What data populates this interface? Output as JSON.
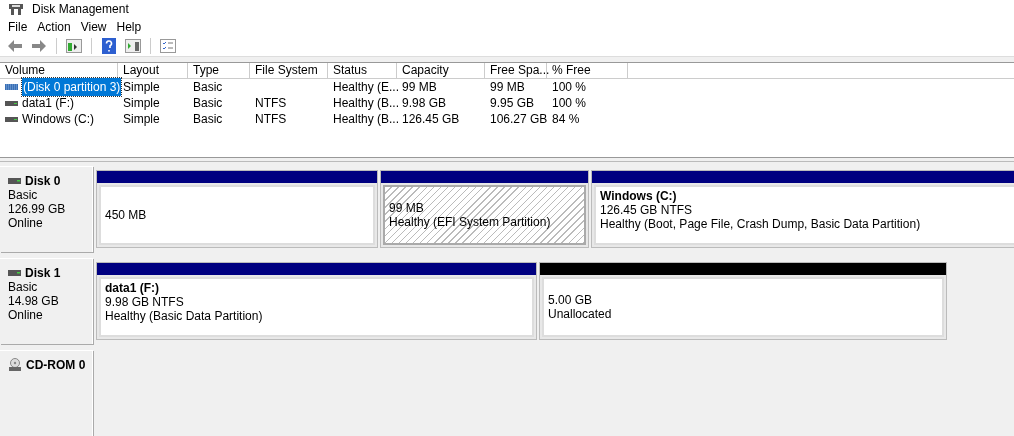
{
  "window": {
    "title": "Disk Management"
  },
  "menu": [
    "File",
    "Action",
    "View",
    "Help"
  ],
  "table": {
    "columns": [
      "Volume",
      "Layout",
      "Type",
      "File System",
      "Status",
      "Capacity",
      "Free Spa...",
      "% Free"
    ],
    "rows": [
      {
        "cells": [
          "(Disk 0 partition 3)",
          "Simple",
          "Basic",
          "",
          "Healthy (E...",
          "99 MB",
          "99 MB",
          "100 %"
        ],
        "kind": "system",
        "selected": true
      },
      {
        "cells": [
          "data1 (F:)",
          "Simple",
          "Basic",
          "NTFS",
          "Healthy (B...",
          "9.98 GB",
          "9.95 GB",
          "100 %"
        ],
        "kind": "drive",
        "selected": false
      },
      {
        "cells": [
          "Windows (C:)",
          "Simple",
          "Basic",
          "NTFS",
          "Healthy (B...",
          "126.45 GB",
          "106.27 GB",
          "84 %"
        ],
        "kind": "drive",
        "selected": false
      }
    ]
  },
  "disks": [
    {
      "name": "Disk 0",
      "kind": "disk",
      "lines": [
        "Basic",
        "126.99 GB",
        "Online"
      ],
      "partitions": [
        {
          "kind": "primary",
          "selected": false,
          "lines": [
            "450 MB"
          ]
        },
        {
          "kind": "primary",
          "selected": true,
          "lines": [
            "99 MB",
            "Healthy (EFI System Partition)"
          ]
        },
        {
          "kind": "primary",
          "selected": false,
          "name": "Windows  (C:)",
          "lines": [
            "126.45 GB NTFS",
            "Healthy (Boot, Page File, Crash Dump, Basic Data Partition)"
          ]
        }
      ]
    },
    {
      "name": "Disk 1",
      "kind": "disk",
      "lines": [
        "Basic",
        "14.98 GB",
        "Online"
      ],
      "partitions": [
        {
          "kind": "primary",
          "selected": false,
          "name": "data1  (F:)",
          "lines": [
            "9.98 GB NTFS",
            "Healthy (Basic Data Partition)"
          ]
        },
        {
          "kind": "unallocated",
          "selected": false,
          "lines": [
            "5.00 GB",
            "Unallocated"
          ]
        }
      ]
    },
    {
      "name": "CD-ROM 0",
      "kind": "cdrom"
    }
  ]
}
